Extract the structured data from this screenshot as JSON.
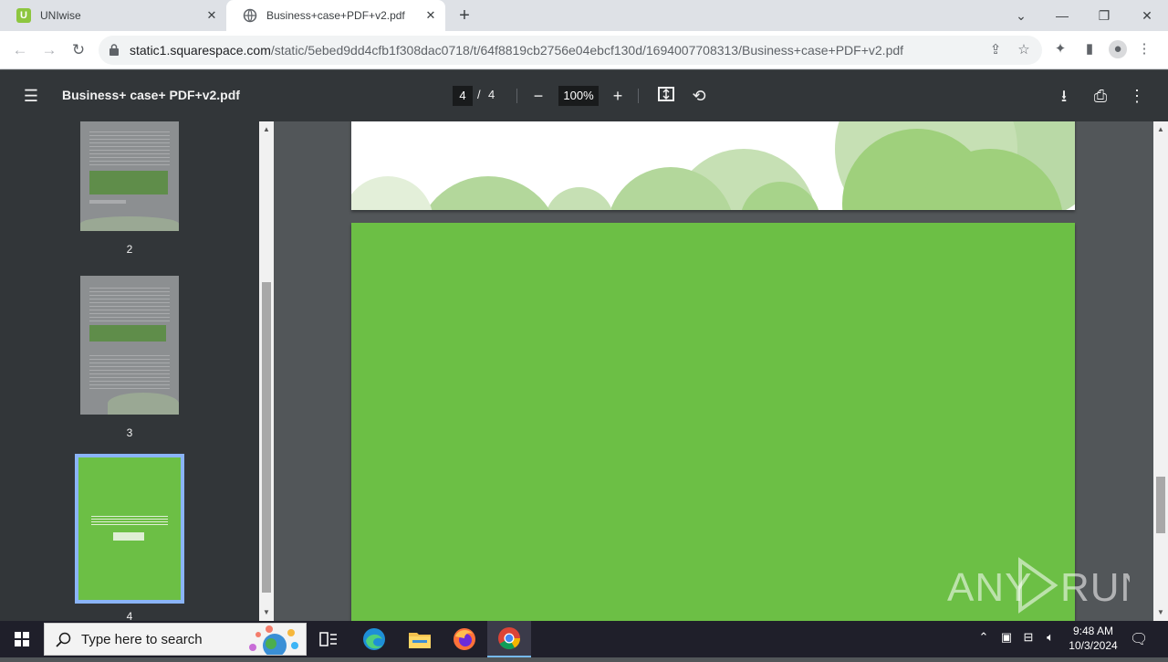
{
  "browser": {
    "tabs": [
      {
        "title": "UNIwise",
        "favicon": "uniwise-icon"
      },
      {
        "title": "Business+case+PDF+v2.pdf",
        "favicon": "globe-icon"
      }
    ],
    "url_host": "static1.squarespace.com",
    "url_path": "/static/5ebed9dd4cfb1f308dac0718/t/64f8819cb2756e04ebcf130d/1694007708313/Business+case+PDF+v2.pdf"
  },
  "pdf": {
    "title": "Business+ case+ PDF+v2.pdf",
    "current_page": "4",
    "separator": "/",
    "total_pages": "4",
    "zoom": "100%",
    "thumbnails": [
      {
        "label": "2"
      },
      {
        "label": "3"
      },
      {
        "label": "4"
      }
    ],
    "page_color": "#6cbf45"
  },
  "watermark": "ANY RUN",
  "taskbar": {
    "search_placeholder": "Type here to search",
    "time": "9:48 AM",
    "date": "10/3/2024"
  }
}
